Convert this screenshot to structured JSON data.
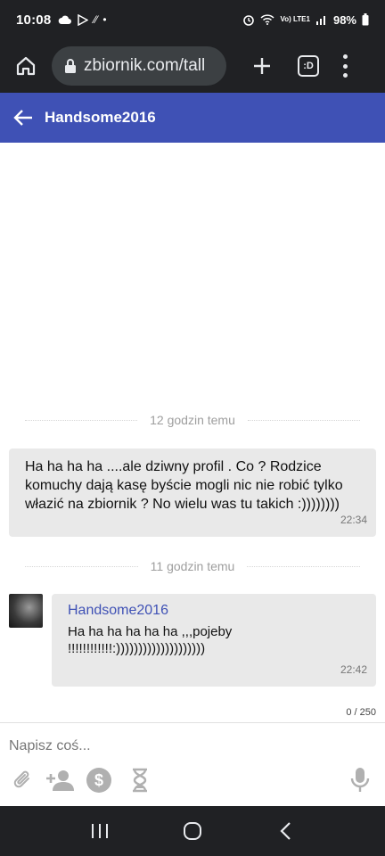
{
  "status_bar": {
    "time": "10:08",
    "network": "Vo) LTE1",
    "battery": "98%"
  },
  "browser": {
    "url": "zbiornik.com/tall",
    "tabs_label": ":D"
  },
  "chat": {
    "title": "Handsome2016",
    "accent_color": "#3f51b5",
    "dividers": [
      "12 godzin temu",
      "11 godzin temu"
    ],
    "messages": [
      {
        "own": true,
        "text": "Ha ha ha ha ....ale dziwny profil . Co ? Rodzice komuchy dają kasę byście mogli nic nie robić tylko włazić na zbiornik ? No wielu was tu takich :))))))))",
        "time": "22:34"
      },
      {
        "own": false,
        "author": "Handsome2016",
        "text": "Ha ha ha ha ha ha ,,,pojeby !!!!!!!!!!!!:))))))))))))))))))))",
        "time": "22:42"
      }
    ]
  },
  "composer": {
    "placeholder": "Napisz coś...",
    "char_count": "0 / 250",
    "tools": [
      "paperclip-icon",
      "add-person-icon",
      "dollar-icon",
      "hourglass-icon",
      "microphone-icon"
    ]
  }
}
